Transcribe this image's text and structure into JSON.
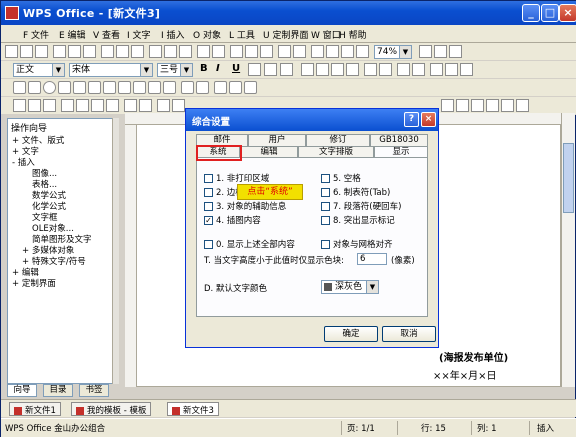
{
  "window": {
    "title": "WPS Office - [新文件3]"
  },
  "menu": [
    "F 文件",
    "E 编辑",
    "V 查看",
    "I 文字",
    "I 插入",
    "O 对象",
    "L 工具",
    "U 定制界面",
    "W 窗口",
    "H 帮助"
  ],
  "toolbar": {
    "zoom": "74%",
    "style": "正文",
    "font": "宋体",
    "size": "三号",
    "bold": "B",
    "italic": "I",
    "underline": "U"
  },
  "left_panel": {
    "title": "操作向导",
    "items": [
      "+ 文件、版式",
      "+ 文字",
      "- 插入",
      "图像...",
      "表格...",
      "数学公式",
      "化学公式",
      "文字框",
      "OLE对象...",
      "简单图形及文字",
      "+ 多媒体对象",
      "+ 特殊文字/符号",
      "+ 编辑",
      "+ 定制界面"
    ],
    "tabs": [
      "向导",
      "目录",
      "书签"
    ]
  },
  "document": {
    "line1": "(海报发布单位)",
    "line2": "××年×月×日"
  },
  "dialog": {
    "title": "综合设置",
    "tabs_back": [
      "邮件",
      "用户",
      "修订",
      "GB18030"
    ],
    "tabs_front": [
      "系统",
      "编辑",
      "文字排版",
      "显示"
    ],
    "callout": "点击“系统”",
    "options": [
      "1. 非打印区域",
      "2. 边框",
      "3. 对象的辅助信息",
      "4. 插图内容",
      "5. 空格",
      "6. 制表符(Tab)",
      "7. 段落符(硬回车)",
      "8. 突出显示标记",
      "0. 显示上述全部内容",
      "对象与网格对齐"
    ],
    "threshold_label": "T. 当文字高度小于此值时仅显示色块:",
    "threshold_value": "6",
    "threshold_unit": "(像素)",
    "default_color_label": "D. 默认文字颜色",
    "default_color_value": "深灰色",
    "ok": "确定",
    "cancel": "取消"
  },
  "file_tabs": [
    "新文件1",
    "我的模板 - 模板",
    "新文件3"
  ],
  "status": {
    "app": "WPS Office 金山办公组合",
    "page": "页: 1/1",
    "row": "行: 15",
    "col": "列: 1",
    "mode": "插入"
  }
}
